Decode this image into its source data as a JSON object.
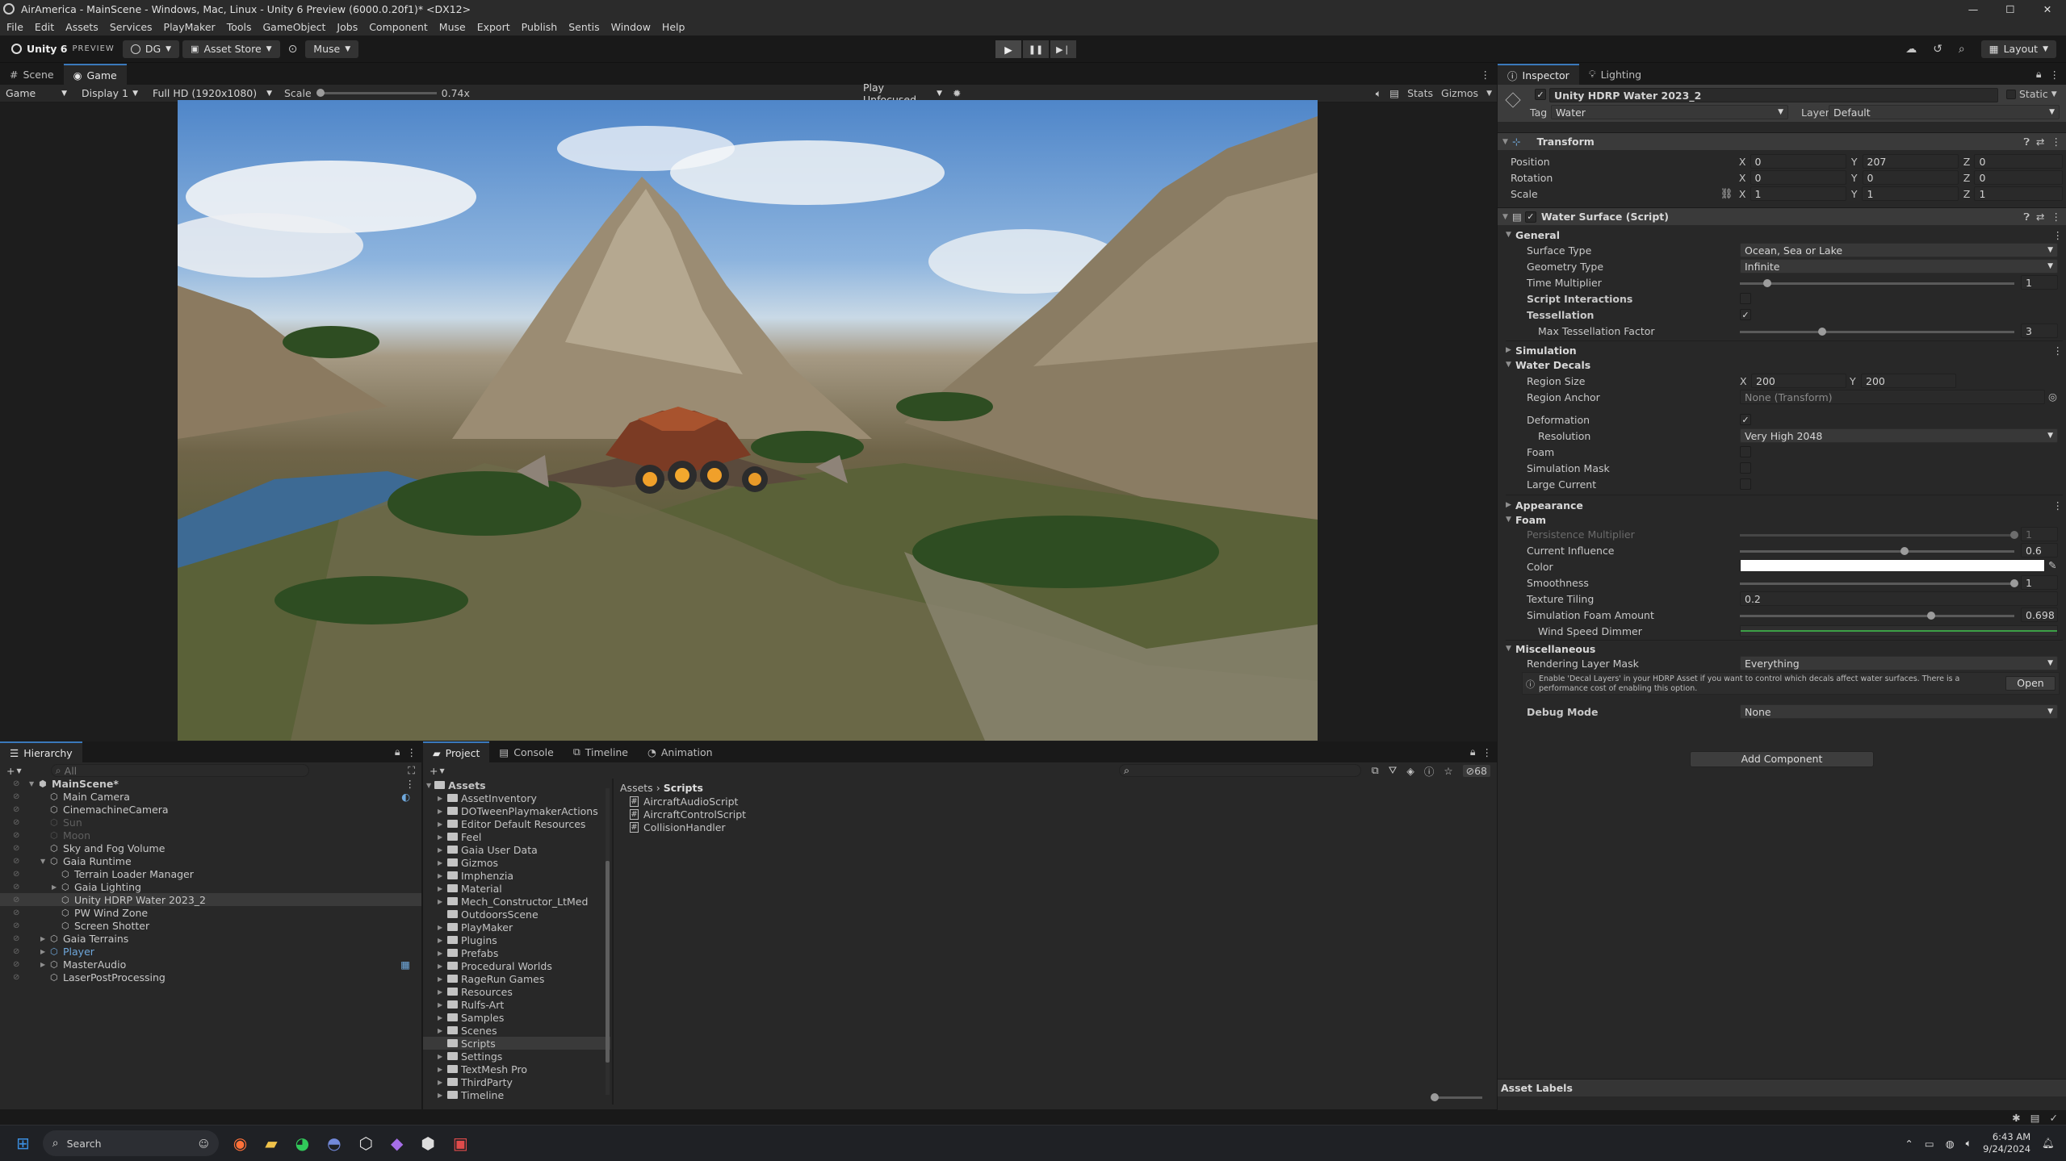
{
  "window": {
    "title": "AirAmerica - MainScene - Windows, Mac, Linux - Unity 6 Preview (6000.0.20f1)* <DX12>",
    "controls": [
      "—",
      "☐",
      "✕"
    ]
  },
  "menu": [
    "File",
    "Edit",
    "Assets",
    "Services",
    "PlayMaker",
    "Tools",
    "GameObject",
    "Jobs",
    "Component",
    "Muse",
    "Export",
    "Publish",
    "Sentis",
    "Window",
    "Help"
  ],
  "toolbar": {
    "unity_label": "Unity 6",
    "preview_label": "PREVIEW",
    "account": "DG",
    "asset_store": "Asset Store",
    "muse": "Muse",
    "layout": "Layout"
  },
  "scene_tabs": {
    "scene": "Scene",
    "game": "Game"
  },
  "game_bar": {
    "mode": "Game",
    "display": "Display 1",
    "resolution": "Full HD (1920x1080)",
    "scale_label": "Scale",
    "scale_value": "0.74x",
    "play_focus": "Play Unfocused",
    "stats": "Stats",
    "gizmos": "Gizmos"
  },
  "inspector": {
    "tab_inspector": "Inspector",
    "tab_lighting": "Lighting",
    "object_name": "Unity HDRP Water 2023_2",
    "static": "Static",
    "tag_label": "Tag",
    "tag_value": "Water",
    "layer_label": "Layer",
    "layer_value": "Default",
    "transform": {
      "title": "Transform",
      "rows": [
        {
          "label": "Position",
          "x": "0",
          "y": "207",
          "z": "0"
        },
        {
          "label": "Rotation",
          "x": "0",
          "y": "0",
          "z": "0"
        },
        {
          "label": "Scale",
          "x": "1",
          "y": "1",
          "z": "1"
        }
      ]
    },
    "water": {
      "title": "Water Surface (Script)",
      "general": "General",
      "surface_type_label": "Surface Type",
      "surface_type": "Ocean, Sea or Lake",
      "geometry_type_label": "Geometry Type",
      "geometry_type": "Infinite",
      "time_multiplier_label": "Time Multiplier",
      "time_multiplier": "1",
      "time_multiplier_level": 0.1,
      "script_interactions": "Script Interactions",
      "tessellation": "Tessellation",
      "max_tess_label": "Max Tessellation Factor",
      "max_tess": "3",
      "max_tess_level": 0.3,
      "simulation": "Simulation",
      "water_decals": "Water Decals",
      "region_size_label": "Region Size",
      "region_x": "200",
      "region_y": "200",
      "region_anchor_label": "Region Anchor",
      "region_anchor": "None (Transform)",
      "deformation": "Deformation",
      "resolution_label": "Resolution",
      "resolution": "Very High 2048",
      "foam_toggle": "Foam",
      "simulation_mask": "Simulation Mask",
      "large_current": "Large Current",
      "appearance": "Appearance",
      "foam": "Foam",
      "persistence_label": "Persistence Multiplier",
      "persistence": "1",
      "persistence_level": 1.0,
      "current_influence_label": "Current Influence",
      "current_influence": "0.6",
      "current_influence_level": 0.6,
      "color_label": "Color",
      "smoothness_label": "Smoothness",
      "smoothness": "1",
      "smoothness_level": 1.0,
      "texture_tiling_label": "Texture Tiling",
      "texture_tiling": "0.2",
      "sim_foam_label": "Simulation Foam Amount",
      "sim_foam": "0.698",
      "sim_foam_level": 0.698,
      "wind_dimmer_label": "Wind Speed Dimmer",
      "misc": "Miscellaneous",
      "rendering_layer_label": "Rendering Layer Mask",
      "rendering_layer": "Everything",
      "info_text": "Enable 'Decal Layers' in your HDRP Asset if you want to control which decals affect water surfaces. There is a performance cost of enabling this option.",
      "open_button": "Open",
      "debug_mode_label": "Debug Mode",
      "debug_mode": "None"
    },
    "add_component": "Add Component",
    "asset_labels": "Asset Labels"
  },
  "hierarchy": {
    "tab": "Hierarchy",
    "search_placeholder": "All",
    "items": [
      {
        "label": "MainScene*",
        "depth": 0,
        "expand": "▼",
        "dim": false
      },
      {
        "label": "Main Camera",
        "depth": 1,
        "expand": "",
        "dim": false
      },
      {
        "label": "CinemachineCamera",
        "depth": 1,
        "expand": "",
        "dim": false
      },
      {
        "label": "Sun",
        "depth": 1,
        "expand": "",
        "dim": true
      },
      {
        "label": "Moon",
        "depth": 1,
        "expand": "",
        "dim": true
      },
      {
        "label": "Sky and Fog Volume",
        "depth": 1,
        "expand": "",
        "dim": false
      },
      {
        "label": "Gaia Runtime",
        "depth": 1,
        "expand": "▼",
        "dim": false
      },
      {
        "label": "Terrain Loader Manager",
        "depth": 2,
        "expand": "",
        "dim": false
      },
      {
        "label": "Gaia Lighting",
        "depth": 2,
        "expand": "▶",
        "dim": false
      },
      {
        "label": "Unity HDRP Water 2023_2",
        "depth": 2,
        "expand": "",
        "dim": false
      },
      {
        "label": "PW Wind Zone",
        "depth": 2,
        "expand": "",
        "dim": false
      },
      {
        "label": "Screen Shotter",
        "depth": 2,
        "expand": "",
        "dim": false
      },
      {
        "label": "Gaia Terrains",
        "depth": 1,
        "expand": "▶",
        "dim": false
      },
      {
        "label": "Player",
        "depth": 1,
        "expand": "▶",
        "dim": false
      },
      {
        "label": "MasterAudio",
        "depth": 1,
        "expand": "▶",
        "dim": false
      },
      {
        "label": "LaserPostProcessing",
        "depth": 1,
        "expand": "",
        "dim": false
      }
    ]
  },
  "bottom_tabs": [
    "Project",
    "Console",
    "Timeline",
    "Animation"
  ],
  "project": {
    "asset_count": "68",
    "root": "Assets",
    "folders": [
      "AssetInventory",
      "DOTweenPlaymakerActions",
      "Editor Default Resources",
      "Feel",
      "Gaia User Data",
      "Gizmos",
      "Imphenzia",
      "Material",
      "Mech_Constructor_LtMed",
      "OutdoorsScene",
      "PlayMaker",
      "Plugins",
      "Prefabs",
      "Procedural Worlds",
      "RageRun Games",
      "Resources",
      "Rulfs-Art",
      "Samples",
      "Scenes",
      "Scripts",
      "Settings",
      "TextMesh Pro",
      "ThirdParty",
      "Timeline"
    ],
    "breadcrumb_root": "Assets",
    "breadcrumb_current": "Scripts",
    "files": [
      "AircraftAudioScript",
      "AircraftControlScript",
      "CollisionHandler"
    ]
  },
  "taskbar": {
    "search": "Search",
    "time": "6:43 AM",
    "date": "9/24/2024"
  },
  "colors": {
    "accent": "#3a79bb",
    "selection": "#2c5d87",
    "player_blue": "#6fa8dc",
    "wind_dimmer": "#3ca046"
  }
}
